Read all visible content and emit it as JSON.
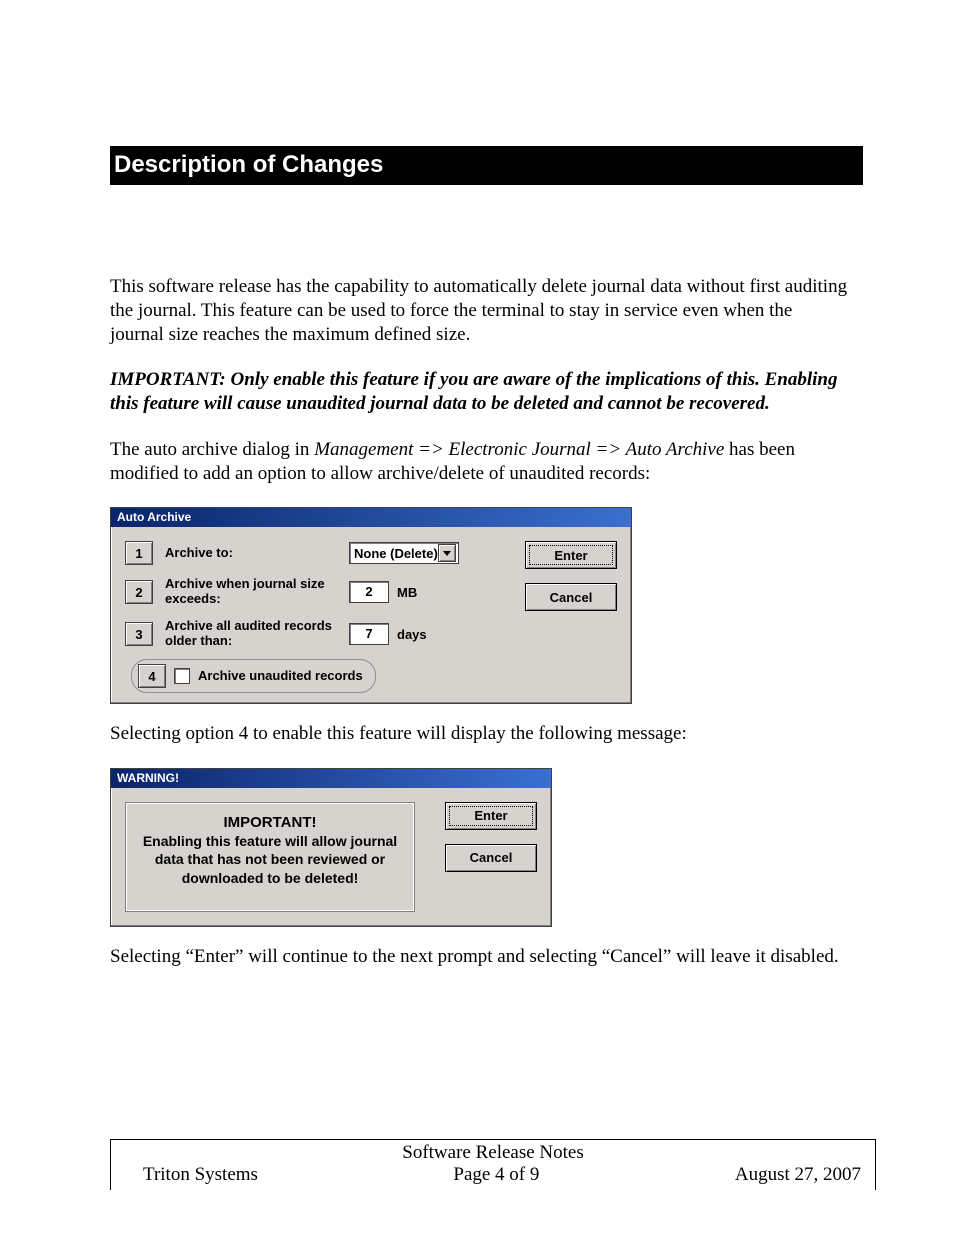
{
  "heading": "Description of Changes",
  "para1": "This software release has the capability to automatically delete journal data without first auditing the journal.  This feature can be used to force the terminal to stay in service even when the journal size reaches the maximum defined size.",
  "important": "IMPORTANT:  Only enable this feature if you are aware of the implications of this.  Enabling this feature will cause unaudited journal data to be deleted and cannot be recovered.",
  "para2_pre": "The auto archive dialog in ",
  "para2_italic": "Management => Electronic Journal => Auto Archive",
  "para2_post": " has been modified to add an option to allow archive/delete of unaudited records:",
  "para3": "Selecting option 4 to enable this feature will display the following message:",
  "para4": "Selecting “Enter” will continue to the next prompt and selecting “Cancel” will leave it disabled.",
  "dialog_archive": {
    "title": "Auto Archive",
    "opt1_num": "1",
    "opt1_label": "Archive to:",
    "opt1_value": "None (Delete)",
    "opt2_num": "2",
    "opt2_label": "Archive when journal size exceeds:",
    "opt2_value": "2",
    "opt2_unit": "MB",
    "opt3_num": "3",
    "opt3_label": "Archive all audited records older than:",
    "opt3_value": "7",
    "opt3_unit": "days",
    "opt4_num": "4",
    "opt4_label": "Archive unaudited records",
    "enter": "Enter",
    "cancel": "Cancel"
  },
  "dialog_warning": {
    "title": "WARNING!",
    "heading": "IMPORTANT!",
    "body": "Enabling this feature will allow journal data that has not been reviewed or downloaded to be deleted!",
    "enter": "Enter",
    "cancel": "Cancel"
  },
  "footer": {
    "doc": "Software Release Notes",
    "company": "Triton Systems",
    "page": "Page 4 of 9",
    "date": "August 27, 2007"
  }
}
